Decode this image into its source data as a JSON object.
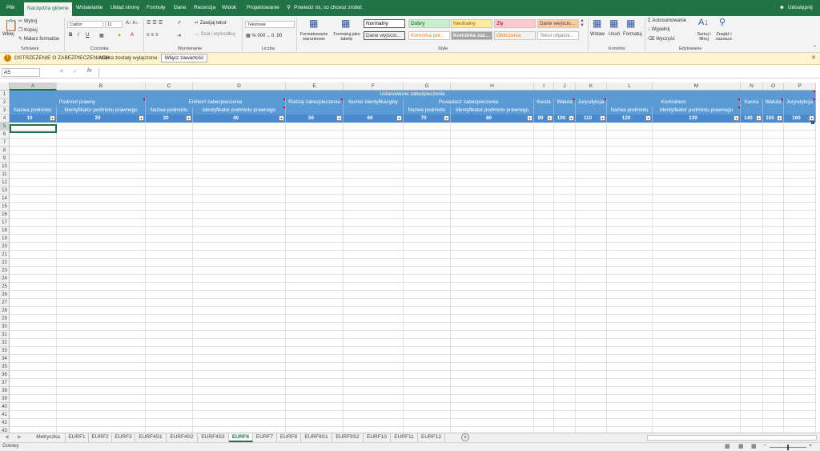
{
  "menu": {
    "tabs": [
      "Plik",
      "Narzędzia główne",
      "Wstawianie",
      "Układ strony",
      "Formuły",
      "Dane",
      "Recenzja",
      "Widok",
      "Projektowanie"
    ],
    "tell_me": "Powiedz mi, co chcesz zrobić",
    "share": "Udostępnij"
  },
  "ribbon": {
    "clipboard": {
      "paste": "Wklej",
      "cut": "Wytnij",
      "copy": "Kopiuj",
      "painter": "Malarz formatów",
      "label": "Schowek"
    },
    "font": {
      "name": "Calibri",
      "size": "11",
      "bold": "B",
      "italic": "I",
      "underline": "U",
      "label": "Czcionka"
    },
    "alignment": {
      "wrap": "Zawijaj tekst",
      "merge": "Scal i wyśrodkuj",
      "label": "Wyrównanie"
    },
    "number": {
      "format": "Tekstowe",
      "label": "Liczba"
    },
    "styles": {
      "cond": "Formatowanie warunkowe",
      "table": "Formatuj jako tabelę",
      "label": "Style",
      "items": [
        {
          "text": "Normalny",
          "bg": "#ffffff",
          "fg": "#000000"
        },
        {
          "text": "Dobry",
          "bg": "#c6efce",
          "fg": "#006100"
        },
        {
          "text": "Neutralny",
          "bg": "#ffeb9c",
          "fg": "#9c5700"
        },
        {
          "text": "Zły",
          "bg": "#ffc7ce",
          "fg": "#9c0006"
        },
        {
          "text": "Dane wejścio...",
          "bg": "#ffcc99",
          "fg": "#3f3f76"
        },
        {
          "text": "Dane wyjścio...",
          "bg": "#f2f2f2",
          "fg": "#3f3f3f"
        },
        {
          "text": "Komórka poł...",
          "bg": "#ffffff",
          "fg": "#fa7d00"
        },
        {
          "text": "Komórka zaz...",
          "bg": "#a5a5a5",
          "fg": "#ffffff"
        },
        {
          "text": "Obliczenia",
          "bg": "#f2f2f2",
          "fg": "#fa7d00"
        },
        {
          "text": "Tekst objaśni...",
          "bg": "#ffffff",
          "fg": "#7f7f7f"
        }
      ]
    },
    "cells": {
      "insert": "Wstaw",
      "delete": "Usuń",
      "format": "Formatuj",
      "label": "Komórki"
    },
    "editing": {
      "autosum": "Autosumowanie",
      "fill": "Wypełnij",
      "clear": "Wyczyść",
      "sort": "Sortuj i filtruj",
      "find": "Znajdź i zaznacz",
      "label": "Edytowanie"
    }
  },
  "security": {
    "title": "OSTRZEŻENIE O ZABEZPIECZENIACH",
    "message": "Makra zostały wyłączone.",
    "button": "Włącz zawartość"
  },
  "formula_bar": {
    "name_box": "A5",
    "fx": "fx",
    "value": ""
  },
  "grid": {
    "columns": [
      "A",
      "B",
      "C",
      "D",
      "E",
      "F",
      "G",
      "H",
      "I",
      "J",
      "K",
      "L",
      "M",
      "N",
      "O",
      "P"
    ],
    "rows": [
      "1",
      "2",
      "3",
      "4",
      "5",
      "6",
      "7",
      "8",
      "9",
      "10",
      "11",
      "12",
      "13",
      "14",
      "15",
      "16",
      "17",
      "18",
      "19",
      "20",
      "21",
      "22",
      "23",
      "24",
      "25",
      "26",
      "27",
      "28",
      "29",
      "30",
      "31",
      "32",
      "33",
      "34",
      "35",
      "36",
      "37",
      "38",
      "39",
      "40",
      "41",
      "42",
      "43"
    ],
    "row1_title": "Ustanowione zabezpieczenie",
    "row2": [
      "Podmiot prawny",
      "Emitent zabezpieczenia",
      "Rodzaj zabezpieczenia",
      "Numer identyfikacyjny",
      "Posiadacz zabezpieczenia",
      "Kwota",
      "Waluta",
      "Jurysdykcja",
      "Kontrahent",
      "Kwota",
      "Waluta",
      "Jurysdykcja"
    ],
    "row3": [
      "Nazwa podmiotu",
      "Identyfikator podmiotu prawnego",
      "Nazwa podmiotu",
      "Identyfikator podmiotu prawnego",
      "Nazwa podmiotu",
      "Identyfikator podmiotu prawnego",
      "Nazwa podmiotu",
      "Identyfikator podmiotu prawnego"
    ],
    "row4": [
      "10",
      "20",
      "30",
      "40",
      "50",
      "60",
      "70",
      "80",
      "90",
      "100",
      "110",
      "120",
      "130",
      "140",
      "150",
      "160"
    ]
  },
  "sheets": {
    "tabs": [
      "Metryczka",
      "EURF1",
      "EURF2",
      "EURF3",
      "EURF4S1",
      "EURF4S2",
      "EURF4S3",
      "EURF6",
      "EURF7",
      "EURF8",
      "EURF9S1",
      "EURF9S2",
      "EURF10",
      "EURF11",
      "EURF12"
    ],
    "active": "EURF6"
  },
  "status": {
    "ready": "Gotowy"
  }
}
